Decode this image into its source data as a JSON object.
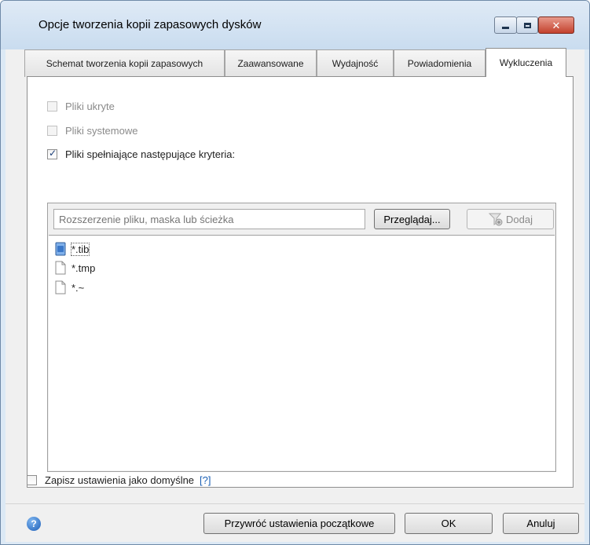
{
  "window": {
    "title": "Opcje tworzenia kopii zapasowych dysków",
    "controls": {
      "minimize": "minimize-icon",
      "maximize": "maximize-icon",
      "close": "close-icon"
    }
  },
  "tabs": [
    {
      "label": "Schemat tworzenia kopii zapasowych",
      "active": false
    },
    {
      "label": "Zaawansowane",
      "active": false
    },
    {
      "label": "Wydajność",
      "active": false
    },
    {
      "label": "Powiadomienia",
      "active": false
    },
    {
      "label": "Wykluczenia",
      "active": true
    }
  ],
  "exclusions": {
    "hidden_files": {
      "label": "Pliki ukryte",
      "checked": false,
      "enabled": false
    },
    "system_files": {
      "label": "Pliki systemowe",
      "checked": false,
      "enabled": false
    },
    "criteria_files": {
      "label": "Pliki spełniające następujące kryteria:",
      "checked": true,
      "enabled": true
    },
    "input": {
      "placeholder": "Rozszerzenie pliku, maska lub ścieżka",
      "value": ""
    },
    "browse_label": "Przeglądaj...",
    "add_label": "Dodaj",
    "items": [
      {
        "text": "*.tib",
        "icon": "tib-file-icon",
        "selected": true
      },
      {
        "text": "*.tmp",
        "icon": "file-icon",
        "selected": false
      },
      {
        "text": "*.~",
        "icon": "file-icon",
        "selected": false
      }
    ]
  },
  "save_default": {
    "label": "Zapisz ustawienia jako domyślne",
    "help": "[?]",
    "checked": false
  },
  "footer": {
    "restore_label": "Przywróć ustawienia początkowe",
    "ok_label": "OK",
    "cancel_label": "Anuluj",
    "help_icon": "help-icon"
  }
}
